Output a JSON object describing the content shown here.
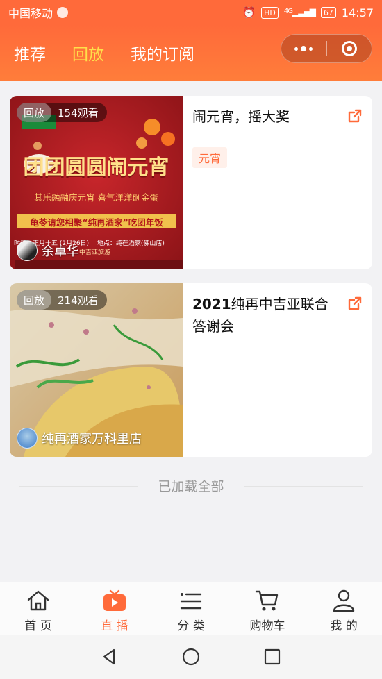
{
  "status_bar": {
    "carrier": "中国移动",
    "hd": "HD",
    "network": "4G",
    "battery": "67",
    "time": "14:57"
  },
  "header": {
    "tabs": [
      {
        "label": "推荐"
      },
      {
        "label": "回放"
      },
      {
        "label": "我的订阅"
      }
    ],
    "active_tab": 1
  },
  "cards": [
    {
      "badge_label": "回放",
      "views": "154观看",
      "host": "余卓华",
      "title": "闹元宵，摇大奖",
      "tag": "元宵",
      "poster": {
        "headline": "团团圆圆闹元宵",
        "subline": "其乐融融庆元宵 喜气洋洋砸金蛋",
        "banner": "龟苓请您相聚“纯再酒家”吃团年饭",
        "time_line": "时间：正月十五 (2月26日) ｜地点：纯在酒家(佛山店)",
        "organizer": "中吉亚旅游"
      }
    },
    {
      "badge_label": "回放",
      "views": "214观看",
      "host": "纯再酒家万科里店",
      "title_num": "2021",
      "title_rest": "纯再中吉亚联合答谢会"
    }
  ],
  "footer_text": "已加载全部",
  "tabbar": [
    {
      "label": "首 页",
      "icon": "home-icon"
    },
    {
      "label": "直 播",
      "icon": "live-tv-icon"
    },
    {
      "label": "分 类",
      "icon": "category-list-icon"
    },
    {
      "label": "购物车",
      "icon": "cart-icon"
    },
    {
      "label": "我 的",
      "icon": "user-icon"
    }
  ],
  "colors": {
    "accent": "#ff6a3a",
    "active_tab": "#ffe04a"
  }
}
